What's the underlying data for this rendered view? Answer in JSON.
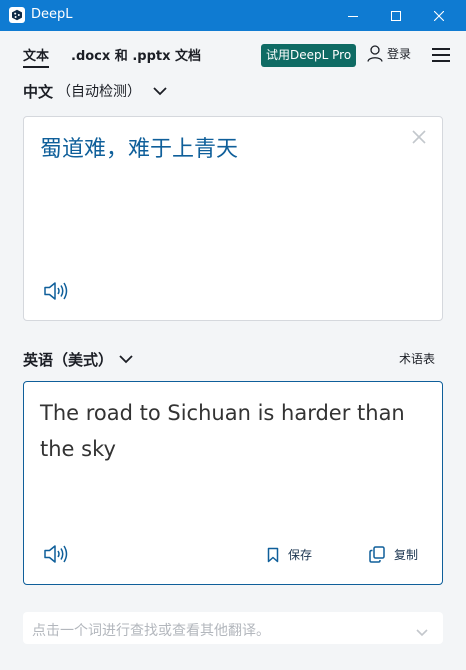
{
  "window": {
    "title": "DeepL"
  },
  "tabs": {
    "text_label": "文本",
    "docs_label": ".docx 和 .pptx 文档"
  },
  "header": {
    "pro_label": "试用DeepL Pro",
    "login_label": "登录"
  },
  "source": {
    "language": "中文",
    "detect_label": "（自动检测）",
    "text": "蜀道难，难于上青天"
  },
  "target": {
    "language": "英语（美式）",
    "glossary_label": "术语表",
    "text": "The road to Sichuan is harder than the sky",
    "save_label": "保存",
    "copy_label": "复制"
  },
  "hint": {
    "text": "点击一个词进行查找或查看其他翻译。"
  },
  "colors": {
    "titlebar": "#0f7bd2",
    "pro_button": "#0f6b64",
    "accent_text": "#0f5f9a",
    "background": "#f3f5f7"
  },
  "icons": [
    "deepl-logo-icon",
    "minimize-icon",
    "maximize-icon",
    "close-icon",
    "user-icon",
    "hamburger-menu-icon",
    "chevron-down-icon",
    "clear-icon",
    "speaker-icon",
    "bookmark-icon",
    "copy-icon"
  ]
}
